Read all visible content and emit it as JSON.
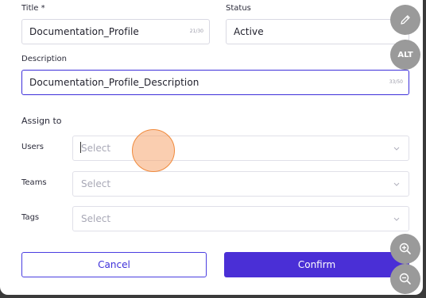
{
  "form": {
    "title_label": "Title *",
    "title_value": "Documentation_Profile",
    "title_counter": "21/30",
    "status_label": "Status",
    "status_value": "Active",
    "description_label": "Description",
    "description_value": "Documentation_Profile_Description",
    "description_counter": "33/50",
    "assign_heading": "Assign to",
    "users_label": "Users",
    "users_placeholder": "Select",
    "teams_label": "Teams",
    "teams_placeholder": "Select",
    "tags_label": "Tags",
    "tags_placeholder": "Select"
  },
  "actions": {
    "cancel_label": "Cancel",
    "confirm_label": "Confirm"
  },
  "floating": {
    "edit_icon": "pencil-icon",
    "alt_label": "ALT",
    "zoom_in_icon": "zoom-in-icon",
    "zoom_out_icon": "zoom-out-icon"
  },
  "colors": {
    "accent": "#4a2fd6",
    "focus_border": "#3d2fd9",
    "touch_indicator": "#f08a3c"
  }
}
